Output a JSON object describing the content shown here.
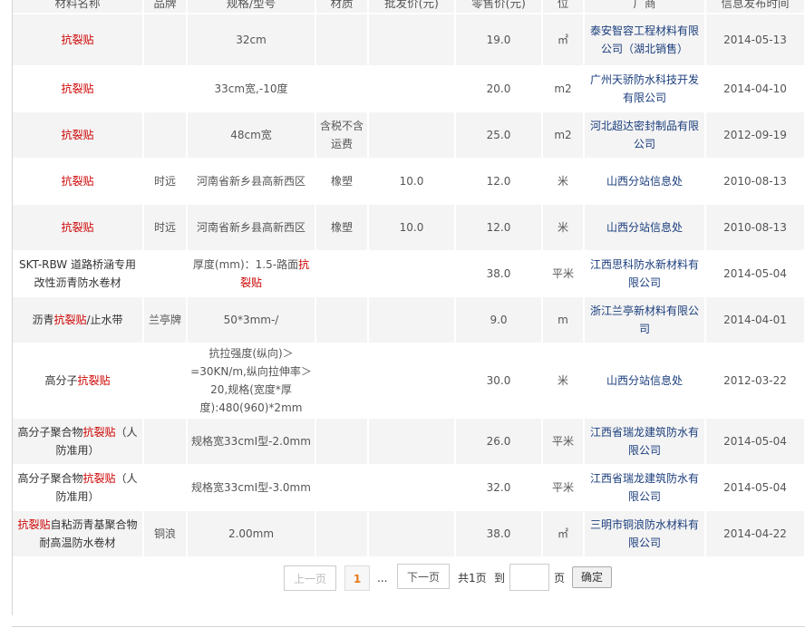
{
  "headers": [
    "材料名称",
    "品牌",
    "规格/型号",
    "材质",
    "批发价(元)",
    "零售价(元)",
    "单位",
    "厂商",
    "信息发布时间"
  ],
  "unit_header_visible": "位",
  "rows": [
    {
      "name_pre": "",
      "name_hl": "抗裂贴",
      "name_post": "",
      "brand": "",
      "spec_pre": "32cm",
      "spec_hl": "",
      "material": "",
      "wholesale": "",
      "retail": "19.0",
      "unit": "㎡",
      "supplier": "泰安智容工程材料有限公司（湖北销售）",
      "date": "2014-05-13",
      "height": 58
    },
    {
      "name_pre": "",
      "name_hl": "抗裂贴",
      "name_post": "",
      "brand": "",
      "spec_pre": "33cm宽,-10度",
      "spec_hl": "",
      "material": "",
      "wholesale": "",
      "retail": "20.0",
      "unit": "m2",
      "supplier": "广州天骄防水科技开发有限公司",
      "date": "2014-04-10",
      "height": 50
    },
    {
      "name_pre": "",
      "name_hl": "抗裂贴",
      "name_post": "",
      "brand": "",
      "spec_pre": "48cm宽",
      "spec_hl": "",
      "material": "含税不含运费",
      "wholesale": "",
      "retail": "25.0",
      "unit": "m2",
      "supplier": "河北超达密封制品有限公司",
      "date": "2012-09-19",
      "height": 52
    },
    {
      "name_pre": "",
      "name_hl": "抗裂贴",
      "name_post": "",
      "brand": "时远",
      "spec_pre": "河南省新乡县高新西区",
      "spec_hl": "",
      "material": "橡塑",
      "wholesale": "10.0",
      "retail": "12.0",
      "unit": "米",
      "supplier": "山西分站信息处",
      "date": "2010-08-13",
      "height": 50
    },
    {
      "name_pre": "",
      "name_hl": "抗裂贴",
      "name_post": "",
      "brand": "时远",
      "spec_pre": "河南省新乡县高新西区",
      "spec_hl": "",
      "material": "橡塑",
      "wholesale": "10.0",
      "retail": "12.0",
      "unit": "米",
      "supplier": "山西分站信息处",
      "date": "2010-08-13",
      "height": 52
    },
    {
      "name_pre": "SKT-RBW 道路桥涵专用改性沥青防水卷材",
      "name_hl": "",
      "name_post": "",
      "brand": "",
      "spec_pre": "厚度(mm)：1.5-路面",
      "spec_hl": "抗裂贴",
      "material": "",
      "wholesale": "",
      "retail": "38.0",
      "unit": "平米",
      "supplier": "江西思科防水新材料有限公司",
      "date": "2014-05-04",
      "height": 50
    },
    {
      "name_pre": "沥青",
      "name_hl": "抗裂贴",
      "name_post": "/止水带",
      "brand": "兰亭牌",
      "spec_pre": "50*3mm-/",
      "spec_hl": "",
      "material": "",
      "wholesale": "",
      "retail": "9.0",
      "unit": "m",
      "supplier": "浙江兰亭新材料有限公司",
      "date": "2014-04-01",
      "height": 52
    },
    {
      "name_pre": "高分子",
      "name_hl": "抗裂贴",
      "name_post": "",
      "brand": "",
      "spec_pre": "抗拉强度(纵向)＞=30KN/m,纵向拉伸率＞20,规格(宽度*厚度):480(960)*2mm",
      "spec_hl": "",
      "material": "",
      "wholesale": "",
      "retail": "30.0",
      "unit": "米",
      "supplier": "山西分站信息处",
      "date": "2012-03-22",
      "height": 80
    },
    {
      "name_pre": "高分子聚合物",
      "name_hl": "抗裂贴",
      "name_post": "（人防准用）",
      "brand": "",
      "spec_pre": "规格宽33cmI型-2.0mm",
      "spec_hl": "",
      "material": "",
      "wholesale": "",
      "retail": "26.0",
      "unit": "平米",
      "supplier": "江西省瑞龙建筑防水有限公司",
      "date": "2014-05-04",
      "height": 52
    },
    {
      "name_pre": "高分子聚合物",
      "name_hl": "抗裂贴",
      "name_post": "（人防准用）",
      "brand": "",
      "spec_pre": "规格宽33cmI型-3.0mm",
      "spec_hl": "",
      "material": "",
      "wholesale": "",
      "retail": "32.0",
      "unit": "平米",
      "supplier": "江西省瑞龙建筑防水有限公司",
      "date": "2014-05-04",
      "height": 50
    },
    {
      "name_pre": "",
      "name_hl": "抗裂贴",
      "name_post": "自粘沥青基聚合物耐高温防水卷材",
      "brand": "铜浪",
      "spec_pre": "2.00mm",
      "spec_hl": "",
      "material": "",
      "wholesale": "",
      "retail": "38.0",
      "unit": "㎡",
      "supplier": "三明市铜浪防水材料有限公司",
      "date": "2014-04-22",
      "height": 52
    }
  ],
  "pager": {
    "prev_label": "上一页",
    "current_page": "1",
    "ellipsis": "...",
    "next_label": "下一页",
    "total_pages": "共1页",
    "goto_label": "到",
    "page_suffix": "页",
    "go_input_value": "",
    "confirm_label": "确定"
  }
}
